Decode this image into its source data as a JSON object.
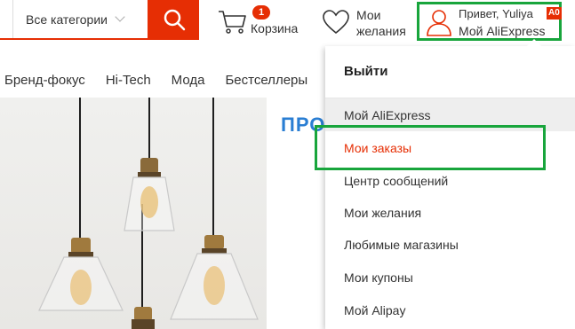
{
  "header": {
    "category_label": "Все категории",
    "cart": {
      "count": "1",
      "label": "Корзина"
    },
    "wishlist": {
      "line1": "Мои",
      "line2": "желания"
    },
    "account": {
      "greeting": "Привет, Yuliya",
      "link": "Мой AliExpress",
      "badge": "A0"
    }
  },
  "nav": [
    "Бренд-фокус",
    "Hi-Tech",
    "Мода",
    "Бестселлеры"
  ],
  "promo": {
    "title": "ПРО"
  },
  "menu": {
    "logout": "Выйти",
    "items": [
      "Мой AliExpress",
      "Мои заказы",
      "Центр сообщений",
      "Мои желания",
      "Любимые магазины",
      "Мои купоны",
      "Мой Alipay"
    ]
  },
  "colors": {
    "accent": "#e62e04",
    "highlight": "#18a53c",
    "promo": "#2a7ed3"
  }
}
